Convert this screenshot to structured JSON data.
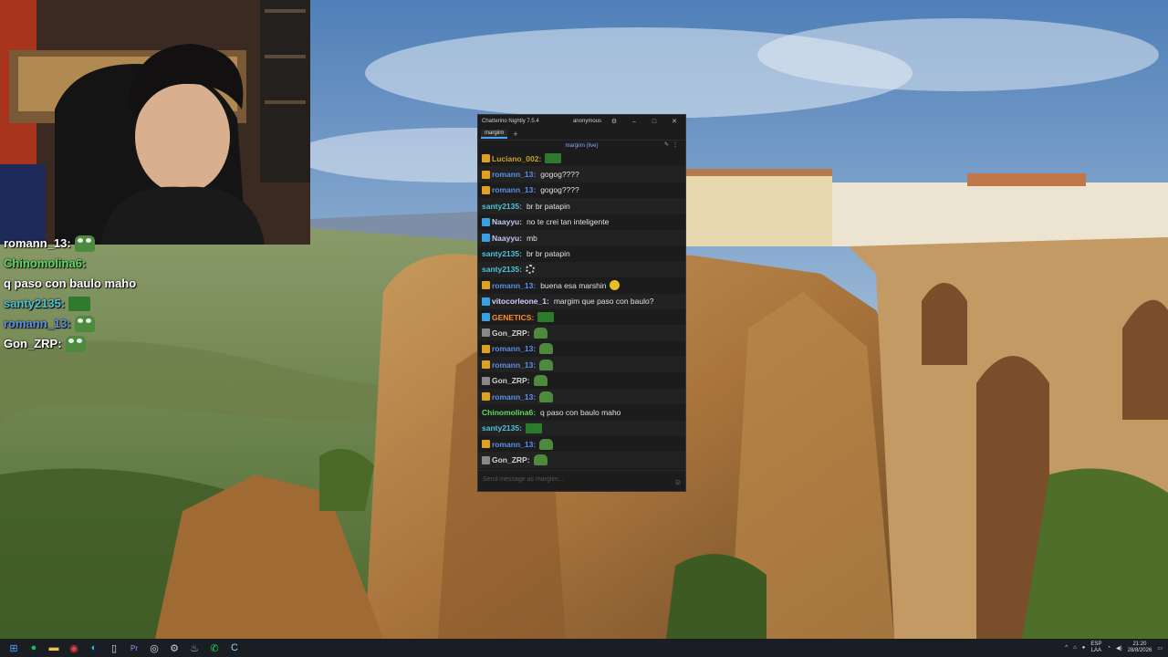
{
  "window": {
    "title": "Chatterino Nightly 7.5.4",
    "account": "anonymous",
    "minimize": "–",
    "maximize": "□",
    "close": "✕",
    "settings_icon": "gear-icon"
  },
  "tabs": [
    {
      "label": "margiim"
    }
  ],
  "tab_add": "+",
  "channel": {
    "label": "margiim (live)"
  },
  "input": {
    "placeholder": "Send message as margiim..."
  },
  "messages": [
    {
      "user": "Luciano_002:",
      "text": "",
      "color": "#c9a227",
      "badge": "sub",
      "emote": "box"
    },
    {
      "user": "romann_13:",
      "text": "gogog????",
      "color": "#5b8fe8",
      "badge": "sub",
      "emote": ""
    },
    {
      "user": "romann_13:",
      "text": "gogog????",
      "color": "#5b8fe8",
      "badge": "sub",
      "emote": ""
    },
    {
      "user": "santy2135:",
      "text": "br br patapin",
      "color": "#4fc3d8",
      "badge": "",
      "emote": ""
    },
    {
      "user": "Naayyu:",
      "text": "no te crei tan inteligente",
      "color": "#c0c8f0",
      "badge": "vip",
      "emote": ""
    },
    {
      "user": "Naayyu:",
      "text": "mb",
      "color": "#c0c8f0",
      "badge": "vip",
      "emote": ""
    },
    {
      "user": "santy2135:",
      "text": "br br patapin",
      "color": "#4fc3d8",
      "badge": "",
      "emote": ""
    },
    {
      "user": "santy2135:",
      "text": "",
      "color": "#4fc3d8",
      "badge": "",
      "emote": "spin"
    },
    {
      "user": "romann_13:",
      "text": "buena esa marshin",
      "color": "#5b8fe8",
      "badge": "sub",
      "emote": "smile"
    },
    {
      "user": "vitocorleone_1:",
      "text": "margim que paso con baulo?",
      "color": "#d0d0ff",
      "badge": "vip",
      "emote": ""
    },
    {
      "user": "GENETICS:",
      "text": "",
      "color": "#ff8c2a",
      "badge": "vip",
      "emote": "box"
    },
    {
      "user": "Gon_ZRP:",
      "text": "",
      "color": "#d0d0d0",
      "badge": "gray",
      "emote": "pepe"
    },
    {
      "user": "romann_13:",
      "text": "",
      "color": "#5b8fe8",
      "badge": "sub",
      "emote": "pepe"
    },
    {
      "user": "romann_13:",
      "text": "",
      "color": "#5b8fe8",
      "badge": "sub",
      "emote": "pepe"
    },
    {
      "user": "Gon_ZRP:",
      "text": "",
      "color": "#d0d0d0",
      "badge": "gray",
      "emote": "pepe"
    },
    {
      "user": "romann_13:",
      "text": "",
      "color": "#5b8fe8",
      "badge": "sub",
      "emote": "pepe"
    },
    {
      "user": "Chinomolina6:",
      "text": "q paso con baulo maho",
      "color": "#5fdc5f",
      "badge": "",
      "emote": ""
    },
    {
      "user": "santy2135:",
      "text": "",
      "color": "#4fc3d8",
      "badge": "",
      "emote": "box"
    },
    {
      "user": "romann_13:",
      "text": "",
      "color": "#5b8fe8",
      "badge": "sub",
      "emote": "pepe"
    },
    {
      "user": "Gon_ZRP:",
      "text": "",
      "color": "#d0d0d0",
      "badge": "gray",
      "emote": "pepe"
    }
  ],
  "overlay": [
    {
      "user": "romann_13:",
      "text": "",
      "color": "#ffffff",
      "emote": "pepe"
    },
    {
      "user": "Chinomolina6:",
      "text": "q paso con baulo maho",
      "color": "#5fdc5f",
      "emote": ""
    },
    {
      "user": "santy2135:",
      "text": "",
      "color": "#4fc3d8",
      "emote": "box"
    },
    {
      "user": "romann_13:",
      "text": "",
      "color": "#5b8fe8",
      "emote": "pepe"
    },
    {
      "user": "Gon_ZRP:",
      "text": "",
      "color": "#ffffff",
      "emote": "pepe"
    }
  ],
  "taskbar": {
    "apps": [
      "windows-start-icon",
      "spotify-icon",
      "file-explorer-icon",
      "chrome-icon",
      "edge-icon",
      "notepad-icon",
      "premiere-icon",
      "obs-icon",
      "settings-icon",
      "steam-icon",
      "whatsapp-icon",
      "chatterino-icon"
    ],
    "lang_top": "ESP",
    "lang_bottom": "LAA",
    "time": "21:20",
    "date": "28/8/2026"
  }
}
